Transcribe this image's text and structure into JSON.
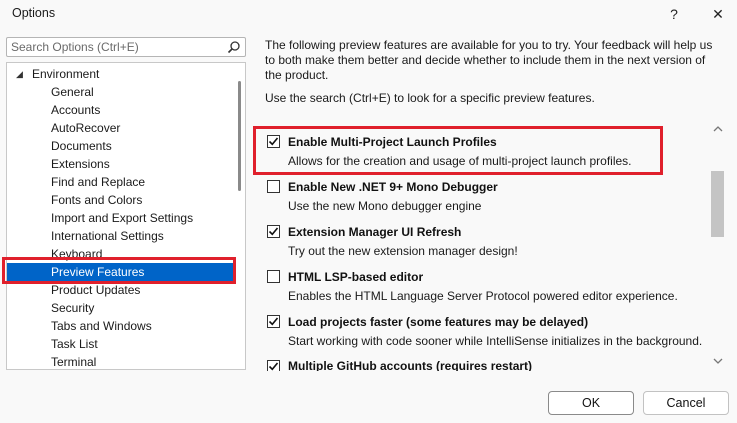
{
  "window": {
    "title": "Options",
    "help_label": "?",
    "close_label": "✕"
  },
  "search": {
    "placeholder": "Search Options (Ctrl+E)"
  },
  "tree": {
    "parent": "Environment",
    "items": [
      "General",
      "Accounts",
      "AutoRecover",
      "Documents",
      "Extensions",
      "Find and Replace",
      "Fonts and Colors",
      "Import and Export Settings",
      "International Settings",
      "Keyboard",
      "Preview Features",
      "Product Updates",
      "Security",
      "Tabs and Windows",
      "Task List",
      "Terminal"
    ],
    "selected": "Preview Features"
  },
  "content": {
    "intro": "The following preview features are available for you to try. Your feedback will help us to both make them better and decide whether to include them in the next version of the product.",
    "search_hint": "Use the search (Ctrl+E) to look for a specific preview features.",
    "features": [
      {
        "title": "Enable Multi-Project Launch Profiles",
        "desc": "Allows for the creation and usage of multi-project launch profiles.",
        "checked": true
      },
      {
        "title": "Enable New .NET 9+ Mono Debugger",
        "desc": "Use the new Mono debugger engine",
        "checked": false
      },
      {
        "title": "Extension Manager UI Refresh",
        "desc": "Try out the new extension manager design!",
        "checked": true
      },
      {
        "title": "HTML LSP-based editor",
        "desc": "Enables the HTML Language Server Protocol powered editor experience.",
        "checked": false
      },
      {
        "title": "Load projects faster (some features may be delayed)",
        "desc": "Start working with code sooner while IntelliSense initializes in the background.",
        "checked": true
      },
      {
        "title": "Multiple GitHub accounts (requires restart)",
        "desc": "",
        "checked": true
      }
    ]
  },
  "footer": {
    "ok_label": "OK",
    "cancel_label": "Cancel"
  },
  "colors": {
    "selection": "#0064c8",
    "highlight_box": "#e0202c"
  },
  "icons": {
    "search": "search-icon",
    "checkbox_check": "checkmark-icon",
    "tree_expander": "caret-down-icon"
  }
}
